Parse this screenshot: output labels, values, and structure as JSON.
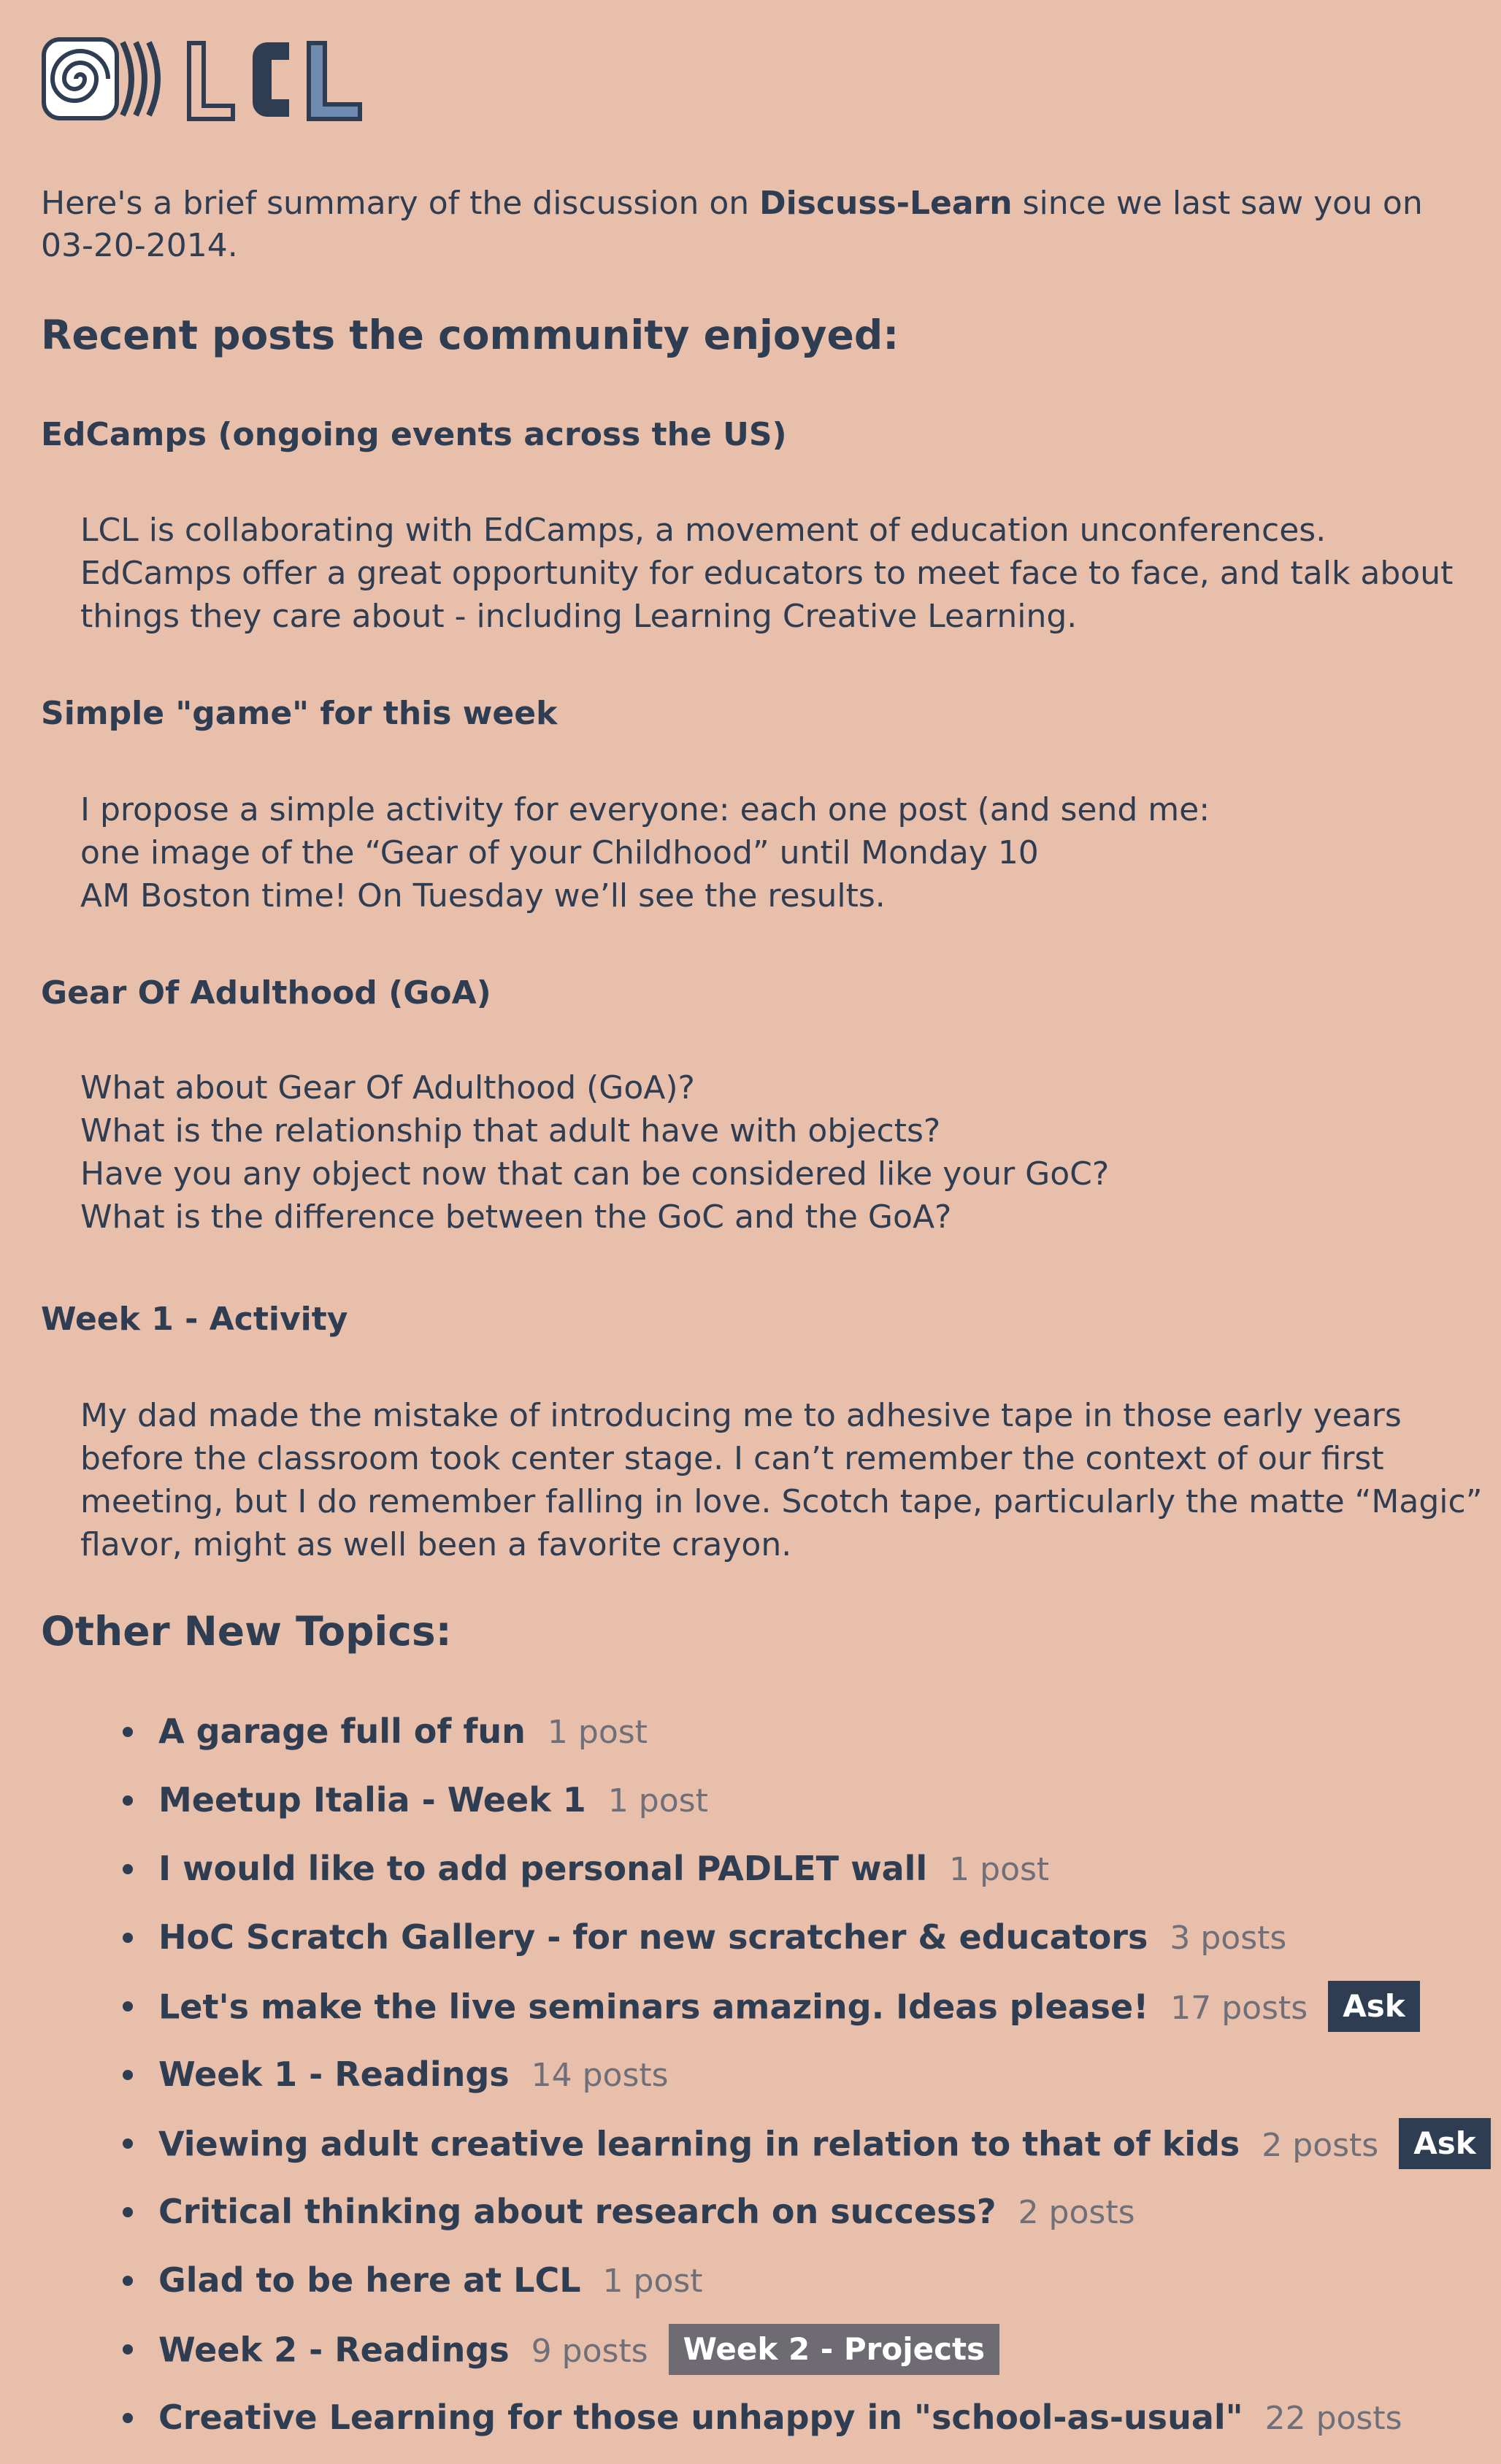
{
  "logo": {
    "text": "LCL",
    "icon": "spiral-logo-icon"
  },
  "summary": {
    "prefix": "Here's a brief summary of the discussion on ",
    "forum": "Discuss-Learn",
    "middle": " since we last saw you on",
    "date": "03-20-2014."
  },
  "recent": {
    "heading": "Recent posts the community enjoyed:",
    "posts": [
      {
        "title": "EdCamps (ongoing events across the US)",
        "lines": [
          "LCL is collaborating with EdCamps, a movement of education unconferences.",
          "EdCamps offer a great opportunity for educators to meet face to face, and talk about",
          "things they care about - including Learning Creative Learning."
        ]
      },
      {
        "title": "Simple \"game\" for this week",
        "lines": [
          "I propose a simple activity for everyone: each one post (and send me:",
          "one image of the “Gear of your Childhood” until Monday 10",
          "AM Boston time! On Tuesday we’ll see the results."
        ]
      },
      {
        "title": "Gear Of Adulthood (GoA)",
        "lines": [
          "What about Gear Of Adulthood (GoA)?",
          "What is the relationship that adult have with objects?",
          "Have you any object now that can be considered like your GoC?",
          "What is the difference between the GoC and the GoA?"
        ]
      },
      {
        "title": "Week 1 - Activity",
        "lines": [
          "My dad made the mistake of introducing me to adhesive tape in those early years",
          "before the classroom took center stage. I can’t remember the context of our first",
          "meeting, but I do remember falling in love. Scotch tape, particularly the matte “Magic”",
          "flavor, might as well been a favorite crayon."
        ]
      }
    ]
  },
  "other": {
    "heading": "Other New Topics:",
    "topics": [
      {
        "title": "A garage full of fun",
        "count": "1 post",
        "badge": ""
      },
      {
        "title": "Meetup Italia - Week 1",
        "count": "1 post",
        "badge": ""
      },
      {
        "title": "I would like to add personal PADLET wall",
        "count": "1 post",
        "badge": ""
      },
      {
        "title": "HoC Scratch Gallery - for new scratcher & educators",
        "count": "3 posts",
        "badge": ""
      },
      {
        "title": "Let's make the live seminars amazing. Ideas please!",
        "count": "17 posts",
        "badge": "Ask",
        "badge_color": "#2f3d52"
      },
      {
        "title": "Week 1 - Readings",
        "count": "14 posts",
        "badge": ""
      },
      {
        "title": "Viewing adult creative learning in relation to that of kids",
        "count": "2 posts",
        "badge": "Ask",
        "badge_color": "#2f3d52"
      },
      {
        "title": "Critical thinking about research on success?",
        "count": "2 posts",
        "badge": ""
      },
      {
        "title": "Glad to be here at LCL",
        "count": "1 post",
        "badge": ""
      },
      {
        "title": "Week 2 - Readings",
        "count": "9 posts",
        "badge": "Week 2 - Projects",
        "badge_color": "#6f6b73"
      },
      {
        "title": "Creative Learning for those unhappy in \"school-as-usual\"",
        "count": "22 posts",
        "badge": ""
      }
    ]
  },
  "colors": {
    "background": "#e8bfab",
    "text": "#2f3d52",
    "muted": "#6e6f78"
  }
}
